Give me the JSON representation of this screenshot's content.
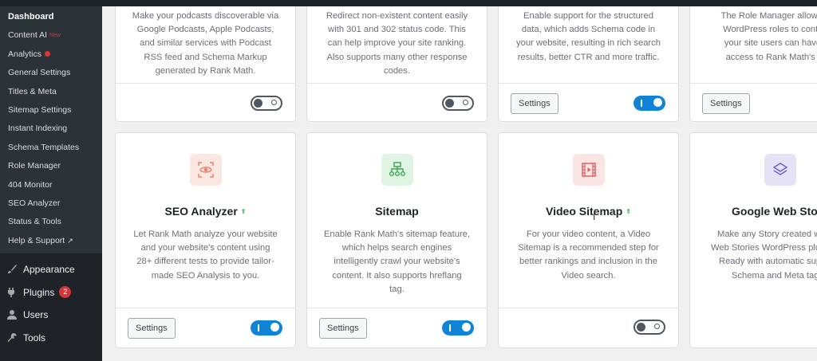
{
  "sidebar": {
    "submenu": [
      {
        "label": "Dashboard",
        "active": true
      },
      {
        "label": "Content AI",
        "badge": "New"
      },
      {
        "label": "Analytics",
        "dot": true
      },
      {
        "label": "General Settings"
      },
      {
        "label": "Titles & Meta"
      },
      {
        "label": "Sitemap Settings"
      },
      {
        "label": "Instant Indexing"
      },
      {
        "label": "Schema Templates"
      },
      {
        "label": "Role Manager"
      },
      {
        "label": "404 Monitor"
      },
      {
        "label": "SEO Analyzer"
      },
      {
        "label": "Status & Tools"
      },
      {
        "label": "Help & Support",
        "icon": "external-link-icon"
      }
    ],
    "menu": [
      {
        "label": "Appearance",
        "icon": "paintbrush-icon"
      },
      {
        "label": "Plugins",
        "icon": "plug-icon",
        "count": "2"
      },
      {
        "label": "Users",
        "icon": "user-icon"
      },
      {
        "label": "Tools",
        "icon": "wrench-icon"
      }
    ]
  },
  "modules_top": [
    {
      "desc": [
        "Make your podcasts discoverable via",
        "Google Podcasts, Apple Podcasts,",
        "and similar services with Podcast",
        "RSS feed and Schema Markup",
        "generated by Rank Math."
      ],
      "settings": false,
      "enabled": false
    },
    {
      "desc": [
        "Redirect non-existent content easily",
        "with 301 and 302 status code. This",
        "can help improve your site ranking.",
        "Also supports many other response",
        "codes."
      ],
      "settings": false,
      "enabled": false
    },
    {
      "desc": [
        "Enable support for the structured",
        "data, which adds Schema code in",
        "your website, resulting in rich search",
        "results, better CTR and more traffic."
      ],
      "settings": true,
      "settings_label": "Settings",
      "enabled": true
    },
    {
      "desc": [
        "The Role Manager allows you",
        "WordPress roles to control w",
        "your site users can have edi",
        "access to Rank Math's setti"
      ],
      "settings": true,
      "settings_label": "Settings",
      "enabled": false
    }
  ],
  "modules": [
    {
      "title": "SEO Analyzer",
      "icon": "eye-scan-icon",
      "icon_bg": "#fbe7e2",
      "icon_color": "#e8826a",
      "up": true,
      "desc": [
        "Let Rank Math analyze your website",
        "and your website's content using",
        "28+ different tests to provide tailor-",
        "made SEO Analysis to you."
      ],
      "settings_label": "Settings",
      "enabled": true
    },
    {
      "title": "Sitemap",
      "icon": "sitemap-icon",
      "icon_bg": "#dff4e3",
      "icon_color": "#3aa457",
      "up": false,
      "desc": [
        "Enable Rank Math's sitemap feature,",
        "which helps search engines",
        "intelligently crawl your website's",
        "content. It also supports hreflang",
        "tag."
      ],
      "settings_label": "Settings",
      "enabled": true
    },
    {
      "title": "Video Sitemap",
      "icon": "video-film-icon",
      "icon_bg": "#fbe4e4",
      "icon_color": "#d95b5b",
      "up": true,
      "desc": [
        "For your video content, a Video",
        "Sitemap is a recommended step for",
        "better rankings and inclusion in the",
        "Video search."
      ],
      "settings_label": "",
      "enabled": false
    },
    {
      "title": "Google Web Stories",
      "icon": "stack-layers-icon",
      "icon_bg": "#e7e3f7",
      "icon_color": "#6e5bc7",
      "up": false,
      "desc": [
        "Make any Story created w",
        "Web Stories WordPress plug",
        "Ready with automatic supp",
        "Schema and Meta tag"
      ],
      "settings_label": "",
      "enabled": false
    }
  ],
  "colors": {
    "sidebar_bg": "#1d2327",
    "submenu_bg": "#2c3338",
    "toggle_on": "#0f83d8",
    "badge": "#d63638"
  }
}
